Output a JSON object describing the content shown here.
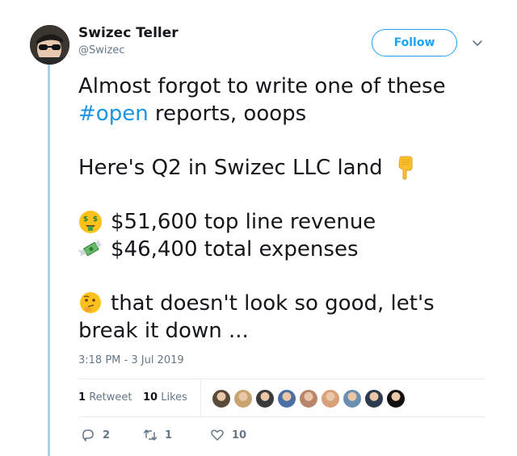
{
  "author": {
    "name": "Swizec Teller",
    "handle": "@Swizec",
    "avatar_icon": "avatar-sunglasses"
  },
  "header": {
    "follow_label": "Follow",
    "more_icon": "chevron-down-icon"
  },
  "tweet": {
    "line1": "Almost forgot to write one of these",
    "hashtag": "#open",
    "line2_rest": " reports, ooops",
    "line3": "Here's Q2 in Swizec LLC land",
    "line3_emoji": "backhand-index-pointing-down",
    "revenue_emoji": "money-mouth-face",
    "revenue": "$51,600 top line revenue",
    "expenses_emoji": "money-with-wings",
    "expenses": "$46,400 total expenses",
    "thinking_emoji": "thinking-face",
    "line6": "that doesn't look so good, let's",
    "line7": "break it down ..."
  },
  "meta": {
    "timestamp": "3:18 PM - 3 Jul 2019"
  },
  "stats": {
    "retweets_count": "1",
    "retweets_label": "Retweet",
    "likes_count": "10",
    "likes_label": "Likes",
    "likers": [
      {
        "color": "#5a4a3a"
      },
      {
        "color": "#c8a46e"
      },
      {
        "color": "#3a3a3a"
      },
      {
        "color": "#4a6fa5"
      },
      {
        "color": "#b8866b"
      },
      {
        "color": "#d9a07a"
      },
      {
        "color": "#6b8fb0"
      },
      {
        "color": "#2e3b4e"
      },
      {
        "color": "#111111"
      }
    ]
  },
  "actions": {
    "reply_count": "2",
    "retweet_count": "1",
    "like_count": "10"
  },
  "colors": {
    "accent": "#1da1f2",
    "hashtag": "#1b95e0",
    "muted": "#657786",
    "thread_line": "#a7d1e6"
  }
}
